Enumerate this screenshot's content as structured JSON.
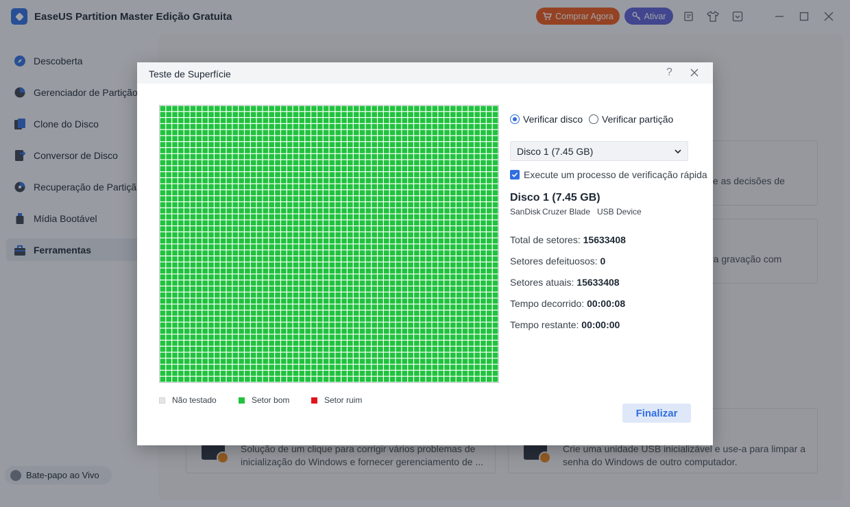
{
  "app": {
    "title": "EaseUS Partition Master Edição Gratuita",
    "buy_label": "Comprar Agora",
    "activate_label": "Ativar",
    "colors": {
      "accent": "#2f6ee0",
      "buy": "#e8591c",
      "activate": "#5b5fd6"
    }
  },
  "sidebar": {
    "items": [
      {
        "label": "Descoberta",
        "icon": "compass-icon"
      },
      {
        "label": "Gerenciador de Partição",
        "icon": "pie-chart-icon"
      },
      {
        "label": "Clone do Disco",
        "icon": "clone-icon"
      },
      {
        "label": "Conversor de Disco",
        "icon": "convert-icon"
      },
      {
        "label": "Recuperação de Partição",
        "icon": "recovery-icon"
      },
      {
        "label": "Mídia Bootável",
        "icon": "usb-icon"
      },
      {
        "label": "Ferramentas",
        "icon": "toolbox-icon",
        "active": true
      }
    ],
    "chat_label": "Bate-papo ao Vivo"
  },
  "background": {
    "card_right_1_text": "te as decisões de",
    "card_right_2_text": "ra gravação com",
    "card_bottom_left_text": "Solução de um clique para corrigir vários problemas de inicialização do Windows e fornecer gerenciamento de ...",
    "card_bottom_right_text": "Crie uma unidade USB inicializável e use-a para limpar a senha do Windows de outro computador."
  },
  "dialog": {
    "title": "Teste de Superfície",
    "help_glyph": "?",
    "grid": {
      "cols": 56,
      "rows": 46,
      "status": "good"
    },
    "legend": [
      {
        "label": "Não testado",
        "color": "#e6e6e6"
      },
      {
        "label": "Setor bom",
        "color": "#21c23e"
      },
      {
        "label": "Setor ruim",
        "color": "#e0141e"
      }
    ],
    "radio_disk": "Verificar disco",
    "radio_partition": "Verificar partição",
    "disk_select": "Disco 1 (7.45 GB)",
    "quick_check_label": "Execute um processo de verificação rápida",
    "disk_name": "Disco 1 (7.45 GB)",
    "disk_vendor": "SanDisk",
    "disk_model": "Cruzer Blade",
    "disk_type": "USB Device",
    "stats": {
      "total_label": "Total de setores:",
      "total_value": "15633408",
      "bad_label": "Setores defeituosos:",
      "bad_value": "0",
      "current_label": "Setores atuais:",
      "current_value": "15633408",
      "elapsed_label": "Tempo decorrido:",
      "elapsed_value": "00:00:08",
      "remaining_label": "Tempo restante:",
      "remaining_value": "00:00:00"
    },
    "finish_label": "Finalizar"
  }
}
